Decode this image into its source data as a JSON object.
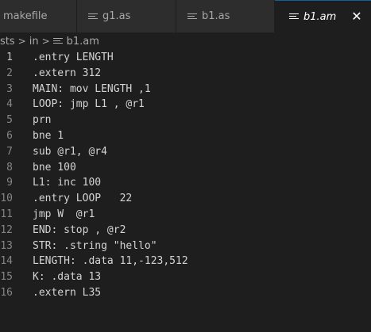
{
  "tabs": [
    {
      "label": "makefile"
    },
    {
      "label": "g1.as"
    },
    {
      "label": "b1.as"
    },
    {
      "label": "b1.am",
      "active": true
    }
  ],
  "breadcrumb": {
    "part1": "sts",
    "part2": "in",
    "file": "b1.am"
  },
  "editor": {
    "lines": [
      {
        "num": "1",
        "text": ".entry LENGTH"
      },
      {
        "num": "2",
        "text": ".extern 312"
      },
      {
        "num": "3",
        "text": "MAIN: mov LENGTH ,1"
      },
      {
        "num": "4",
        "text": "LOOP: jmp L1 , @r1"
      },
      {
        "num": "5",
        "text": "prn"
      },
      {
        "num": "6",
        "text": "bne 1"
      },
      {
        "num": "7",
        "text": "sub @r1, @r4"
      },
      {
        "num": "8",
        "text": "bne 100"
      },
      {
        "num": "9",
        "text": "L1: inc 100"
      },
      {
        "num": "10",
        "text": ".entry LOOP   22"
      },
      {
        "num": "11",
        "text": "jmp W  @r1"
      },
      {
        "num": "12",
        "text": "END: stop , @r2"
      },
      {
        "num": "13",
        "text": "STR: .string \"hello\""
      },
      {
        "num": "14",
        "text": "LENGTH: .data 11,-123,512"
      },
      {
        "num": "15",
        "text": "K: .data 13"
      },
      {
        "num": "16",
        "text": ".extern L35"
      }
    ]
  },
  "colors": {
    "background": "#1e1e1e",
    "tab_inactive": "#2d2d2d",
    "text": "#d4d4d4",
    "line_number": "#858585"
  }
}
